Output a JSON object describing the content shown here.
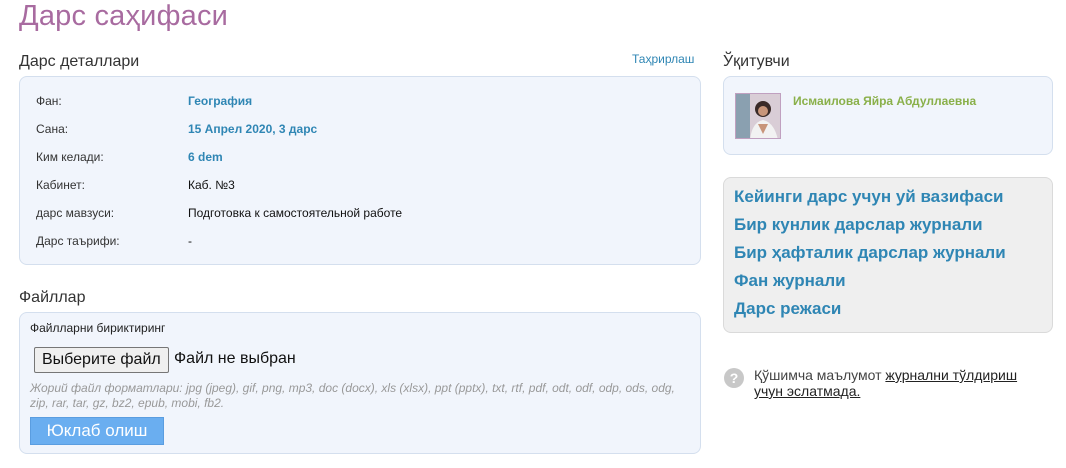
{
  "page": {
    "title": "Дарс саҳифаси"
  },
  "details": {
    "title": "Дарс деталлари",
    "edit_label": "Таҳрирлаш",
    "rows": [
      {
        "label": "Фан:",
        "value": "География"
      },
      {
        "label": "Сана:",
        "value": "15 Апрел 2020, 3 дарс"
      },
      {
        "label": "Ким келади:",
        "value": "6 dem"
      },
      {
        "label": "Кабинет:",
        "value": "Каб. №3"
      },
      {
        "label": "дарс мавзуси:",
        "value": "Подготовка к самостоятельной работе"
      },
      {
        "label": "Дарс таърифи:",
        "value": "-"
      }
    ]
  },
  "files": {
    "title": "Файллар",
    "attach_label": "Файлларни бириктиринг",
    "choose_button": "Выберите файл",
    "choose_status": "Файл не выбран",
    "formats_label": "Жорий файл форматлари:",
    "formats_list": "jpg (jpeg), gif, png, mp3, doc (docx), xls (xlsx), ppt (pptx), txt, rtf, pdf, odt, odf, odp, ods, odg, zip, rar, tar, gz, bz2, epub, mobi, fb2.",
    "upload_button": "Юклаб олиш"
  },
  "teacher": {
    "title": "Ўқитувчи",
    "name": "Исмаилова Яйра Абдуллаевна"
  },
  "links": [
    "Кейинги дарс учун уй вазифаси",
    "Бир кунлик дарслар журнали",
    "Бир ҳафталик дарслар журнали",
    "Фан журнали",
    "Дарс режаси"
  ],
  "help": {
    "icon": "question-circle-icon",
    "text": "Қўшимча маълумот",
    "link": "журнални тўлдириш учун эслатмада."
  },
  "colors": {
    "title": "#a86ba0",
    "link": "#2f86b4",
    "teacher": "#8ab04a",
    "panel": "#f1f5fc",
    "upload": "#6aaef0"
  }
}
